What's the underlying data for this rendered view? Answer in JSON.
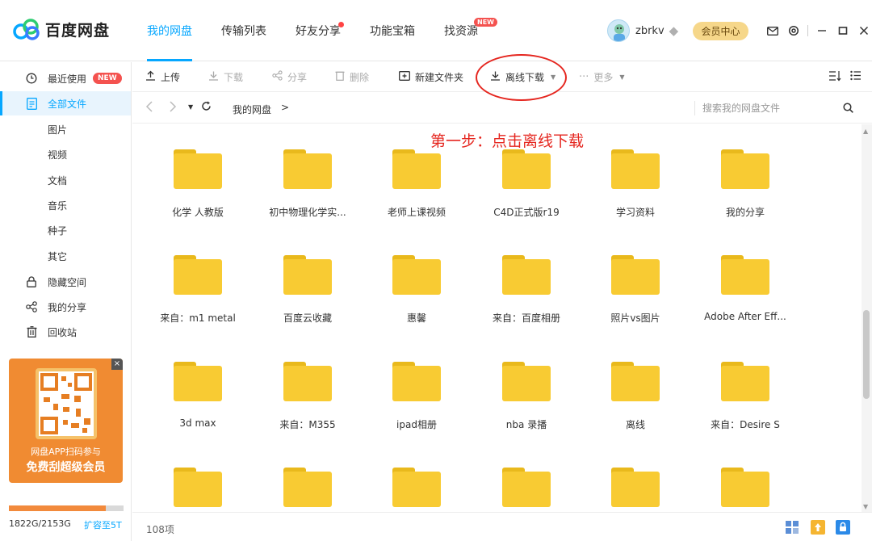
{
  "app": {
    "name": "百度网盘"
  },
  "nav": {
    "items": [
      {
        "label": "我的网盘"
      },
      {
        "label": "传输列表"
      },
      {
        "label": "好友分享"
      },
      {
        "label": "功能宝箱"
      },
      {
        "label": "找资源",
        "badge": "NEW"
      }
    ]
  },
  "user": {
    "name": "zbrkv",
    "vip_button": "会员中心"
  },
  "sidebar": {
    "items": [
      {
        "label": "最近使用",
        "badge": "NEW",
        "icon": "clock-icon"
      },
      {
        "label": "全部文件",
        "icon": "file-list-icon"
      },
      {
        "label": "图片"
      },
      {
        "label": "视频"
      },
      {
        "label": "文档"
      },
      {
        "label": "音乐"
      },
      {
        "label": "种子"
      },
      {
        "label": "其它"
      },
      {
        "label": "隐藏空间",
        "icon": "lock-icon"
      },
      {
        "label": "我的分享",
        "icon": "share-icon"
      },
      {
        "label": "回收站",
        "icon": "trash-icon"
      }
    ],
    "promo": {
      "line1": "网盘APP扫码参与",
      "line2": "免费刮超级会员",
      "close": "×"
    },
    "storage": {
      "text": "1822G/2153G",
      "fraction": 0.846,
      "expand": "扩容至5T"
    }
  },
  "toolbar": {
    "upload": "上传",
    "download": "下载",
    "share": "分享",
    "delete": "删除",
    "new_folder": "新建文件夹",
    "offline_download": "离线下载",
    "more": "更多"
  },
  "address": {
    "root": "我的网盘",
    "separator": ">",
    "search_placeholder": "搜索我的网盘文件"
  },
  "annotation": "第一步：点击离线下载",
  "folders": [
    "化学 人教版",
    "初中物理化学实...",
    "老师上课视频",
    "C4D正式版r19",
    "学习资料",
    "我的分享",
    "来自：m1 metal",
    "百度云收藏",
    "惠馨",
    "来自：百度相册",
    "照片vs图片",
    "Adobe After Eff...",
    "3d max",
    "来自：M355",
    "ipad相册",
    "nba 录播",
    "离线",
    "来自：Desire S",
    "",
    "",
    "",
    "",
    "",
    ""
  ],
  "status": {
    "count": "108项"
  },
  "colors": {
    "accent": "#06a7ff",
    "folder": "#f8cb33",
    "annotation": "#e5261f",
    "promo": "#f08b32"
  }
}
